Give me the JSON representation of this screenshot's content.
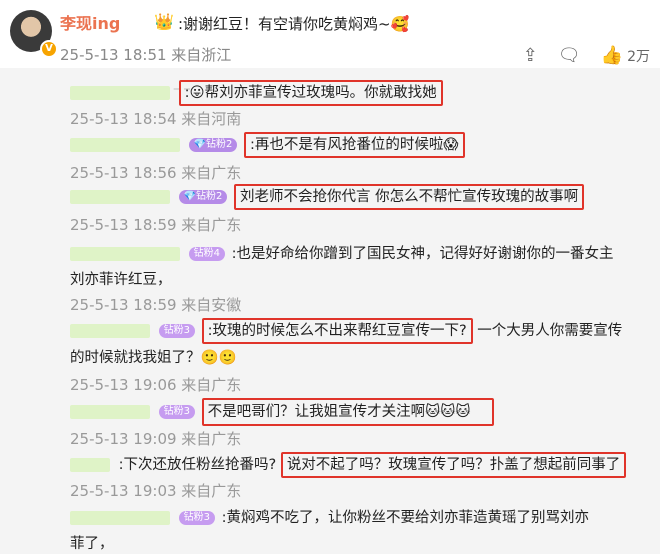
{
  "header": {
    "username": "李现ing",
    "vip_emoji": "👑",
    "text": ":谢谢红豆！有空请你吃黄焖鸡~🥰",
    "meta": "25-5-13 18:51 来自浙江",
    "likes": "2万"
  },
  "comments": [
    {
      "text": ":😛帮刘亦菲宣传过玫瑰吗。你就敢找她",
      "ts": "25-5-13 18:54 来自河南"
    },
    {
      "badge": "💎钻粉2",
      "text": ":再也不是有风抢番位的时候啦😱",
      "ts": "25-5-13 18:56 来自广东"
    },
    {
      "badge": "💎钻粉2",
      "text": "刘老师不会抢你代言 你怎么不帮忙宣传玫瑰的故事啊",
      "ts": "25-5-13 18:59 来自广东"
    },
    {
      "badge": "钻粉4",
      "text": ":也是好命给你蹭到了国民女神，记得好好谢谢你的一番女主",
      "text2": "刘亦菲许红豆，",
      "ts": "25-5-13 18:59 来自安徽"
    },
    {
      "badge": "钻粉3",
      "text": ":玫瑰的时候怎么不出来帮红豆宣传一下?",
      "text_after": "一个大男人你需要宣传",
      "text2": "的时候就找我姐了？🙂🙂",
      "ts": "25-5-13 19:06 来自广东"
    },
    {
      "badge": "钻粉3",
      "text": "不是吧哥们？让我姐宣传才关注啊🐱🐱🐱",
      "ts": "25-5-13 19:09 来自广东"
    },
    {
      "text_before": ":下次还放任粉丝抢番吗?",
      "text": "说对不起了吗？玫瑰宣传了吗？扑盖了想起前同事了",
      "ts": "25-5-13 19:03 来自广东"
    },
    {
      "badge": "钻粉3",
      "text": ":黄焖鸡不吃了，让你粉丝不要给刘亦菲造黄瑶了别骂刘亦",
      "text2": "菲了，"
    }
  ],
  "colors": {
    "highlight": "#e0342a",
    "mask": "#dff3c7",
    "username": "#eb7350"
  },
  "icons": [
    "share-icon",
    "comment-icon",
    "like-icon"
  ]
}
